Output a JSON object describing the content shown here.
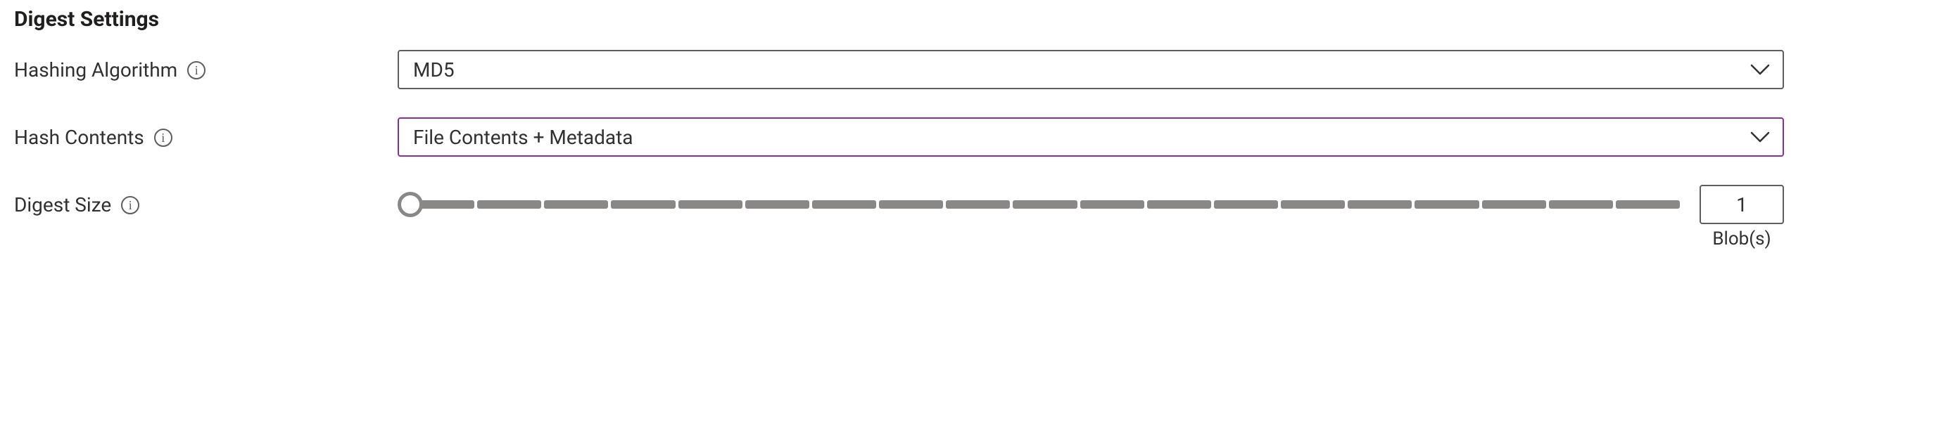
{
  "section_title": "Digest Settings",
  "fields": {
    "hashing_algorithm": {
      "label": "Hashing Algorithm",
      "value": "MD5"
    },
    "hash_contents": {
      "label": "Hash Contents",
      "value": "File Contents + Metadata"
    },
    "digest_size": {
      "label": "Digest Size",
      "value": "1",
      "unit": "Blob(s)",
      "min": 1,
      "max": 20
    }
  }
}
